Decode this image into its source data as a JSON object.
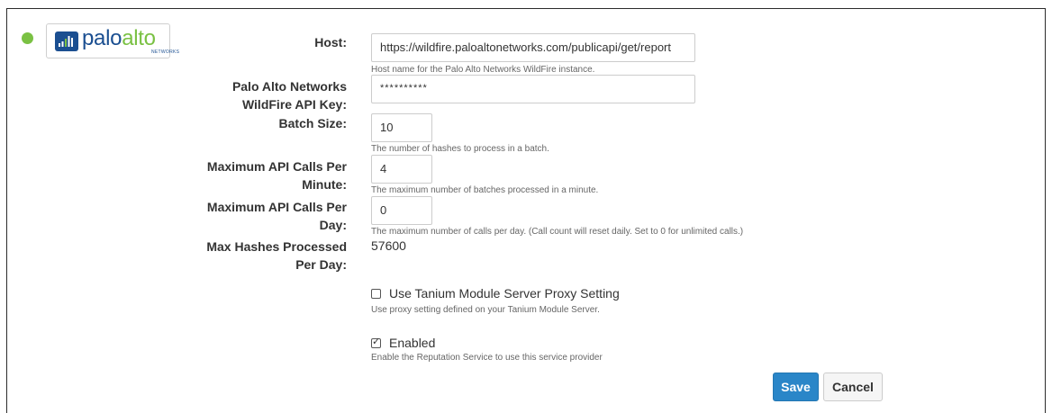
{
  "status": {
    "color": "#7ac143"
  },
  "logo": {
    "text_part1": "palo",
    "text_part2": "alto",
    "subtext": "NETWORKS",
    "icon": "paloalto-logo-icon"
  },
  "fields": {
    "host": {
      "label": "Host:",
      "value": "https://wildfire.paloaltonetworks.com/publicapi/get/report",
      "help": "Host name for the Palo Alto Networks WildFire instance."
    },
    "api_key": {
      "label_line1": "Palo Alto Networks",
      "label_line2": "WildFire API Key:",
      "value": "**********"
    },
    "batch_size": {
      "label": "Batch Size:",
      "value": "10",
      "help": "The number of hashes to process in a batch."
    },
    "max_calls_minute": {
      "label_line1": "Maximum API Calls Per",
      "label_line2": "Minute:",
      "value": "4",
      "help": "The maximum number of batches processed in a minute."
    },
    "max_calls_day": {
      "label_line1": "Maximum API Calls Per",
      "label_line2": "Day:",
      "value": "0",
      "help": "The maximum number of calls per day. (Call count will reset daily. Set to 0 for unlimited calls.)"
    },
    "max_hashes": {
      "label_line1": "Max Hashes Processed",
      "label_line2": "Per Day:",
      "value": "57600"
    }
  },
  "proxy": {
    "checked": false,
    "label": "Use Tanium Module Server Proxy Setting",
    "help": "Use proxy setting defined on your Tanium Module Server."
  },
  "enabled": {
    "checked": true,
    "label": "Enabled",
    "help": "Enable the Reputation Service to use this service provider"
  },
  "buttons": {
    "save": "Save",
    "cancel": "Cancel",
    "save_color": "#2a86c8"
  }
}
